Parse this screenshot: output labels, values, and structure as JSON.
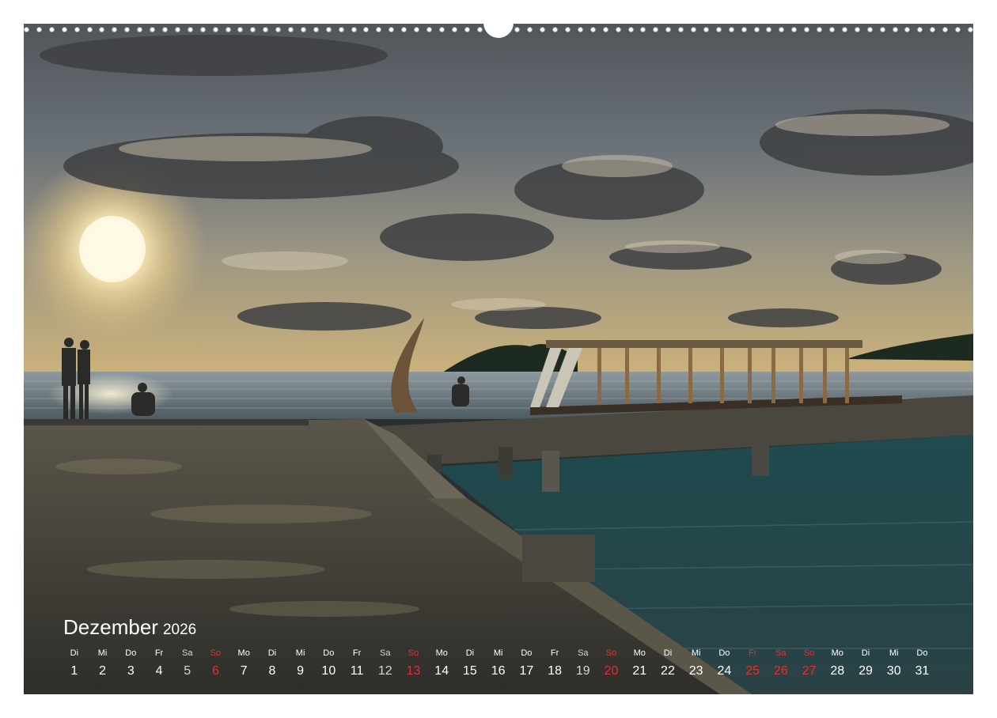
{
  "calendar": {
    "month": "Dezember",
    "year": "2026",
    "days": [
      {
        "wd": "Di",
        "d": "1",
        "t": ""
      },
      {
        "wd": "Mi",
        "d": "2",
        "t": ""
      },
      {
        "wd": "Do",
        "d": "3",
        "t": ""
      },
      {
        "wd": "Fr",
        "d": "4",
        "t": ""
      },
      {
        "wd": "Sa",
        "d": "5",
        "t": "sat"
      },
      {
        "wd": "So",
        "d": "6",
        "t": "sun"
      },
      {
        "wd": "Mo",
        "d": "7",
        "t": ""
      },
      {
        "wd": "Di",
        "d": "8",
        "t": ""
      },
      {
        "wd": "Mi",
        "d": "9",
        "t": ""
      },
      {
        "wd": "Do",
        "d": "10",
        "t": ""
      },
      {
        "wd": "Fr",
        "d": "11",
        "t": ""
      },
      {
        "wd": "Sa",
        "d": "12",
        "t": "sat"
      },
      {
        "wd": "So",
        "d": "13",
        "t": "sun"
      },
      {
        "wd": "Mo",
        "d": "14",
        "t": ""
      },
      {
        "wd": "Di",
        "d": "15",
        "t": ""
      },
      {
        "wd": "Mi",
        "d": "16",
        "t": ""
      },
      {
        "wd": "Do",
        "d": "17",
        "t": ""
      },
      {
        "wd": "Fr",
        "d": "18",
        "t": ""
      },
      {
        "wd": "Sa",
        "d": "19",
        "t": "sat"
      },
      {
        "wd": "So",
        "d": "20",
        "t": "sun"
      },
      {
        "wd": "Mo",
        "d": "21",
        "t": ""
      },
      {
        "wd": "Di",
        "d": "22",
        "t": ""
      },
      {
        "wd": "Mi",
        "d": "23",
        "t": ""
      },
      {
        "wd": "Do",
        "d": "24",
        "t": ""
      },
      {
        "wd": "Fr",
        "d": "25",
        "t": "hol"
      },
      {
        "wd": "Sa",
        "d": "26",
        "t": "hol"
      },
      {
        "wd": "So",
        "d": "27",
        "t": "sun"
      },
      {
        "wd": "Mo",
        "d": "28",
        "t": ""
      },
      {
        "wd": "Di",
        "d": "29",
        "t": ""
      },
      {
        "wd": "Mi",
        "d": "30",
        "t": ""
      },
      {
        "wd": "Do",
        "d": "31",
        "t": ""
      }
    ]
  },
  "colors": {
    "holiday_red": "#e33030",
    "text_white": "#ffffff",
    "saturday_grey": "#d6d6d6"
  }
}
